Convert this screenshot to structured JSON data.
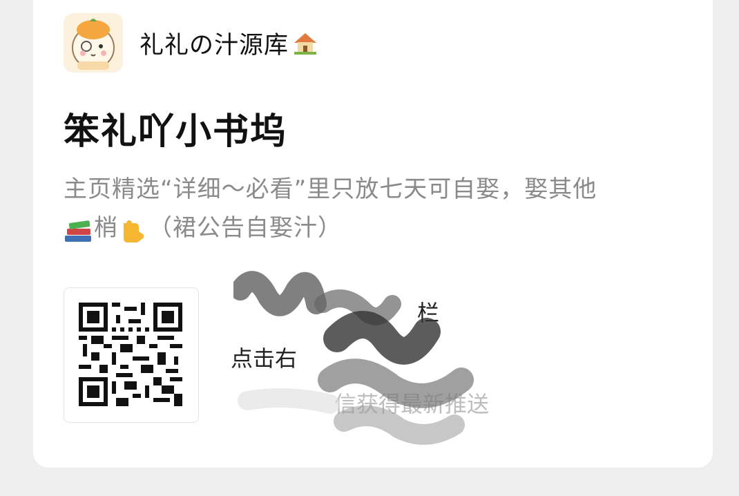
{
  "account": {
    "name": "礼礼の汁源库",
    "avatar_icon": "cat-avatar-icon",
    "badge_icon": "house-icon"
  },
  "title": "笨礼吖小书坞",
  "description": {
    "line1": "主页精选“详细～必看”里只放七天可自娶，娶其他",
    "line2_prefix": "梢",
    "line2_suffix": "（裙公告自娶汁）",
    "icons": [
      "books-icon",
      "pointing-down-icon"
    ]
  },
  "qr_code": {
    "icon": "qr-code-icon"
  },
  "info": {
    "line1": "栏",
    "line2": "点击右",
    "line3": "信获得最新推送"
  }
}
